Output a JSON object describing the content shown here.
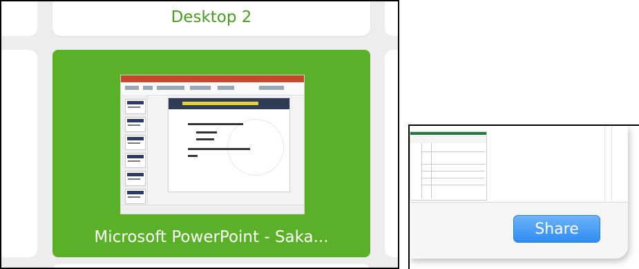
{
  "mission_control": {
    "desktop_label": "Desktop 2",
    "active_window": {
      "app_title": "Microsoft PowerPoint - Saka..."
    },
    "accent_color": "#5ab127",
    "desktop_label_color": "#4c9a22"
  },
  "share_dialog": {
    "share_label": "Share",
    "button_color": "#2e8cf2"
  }
}
